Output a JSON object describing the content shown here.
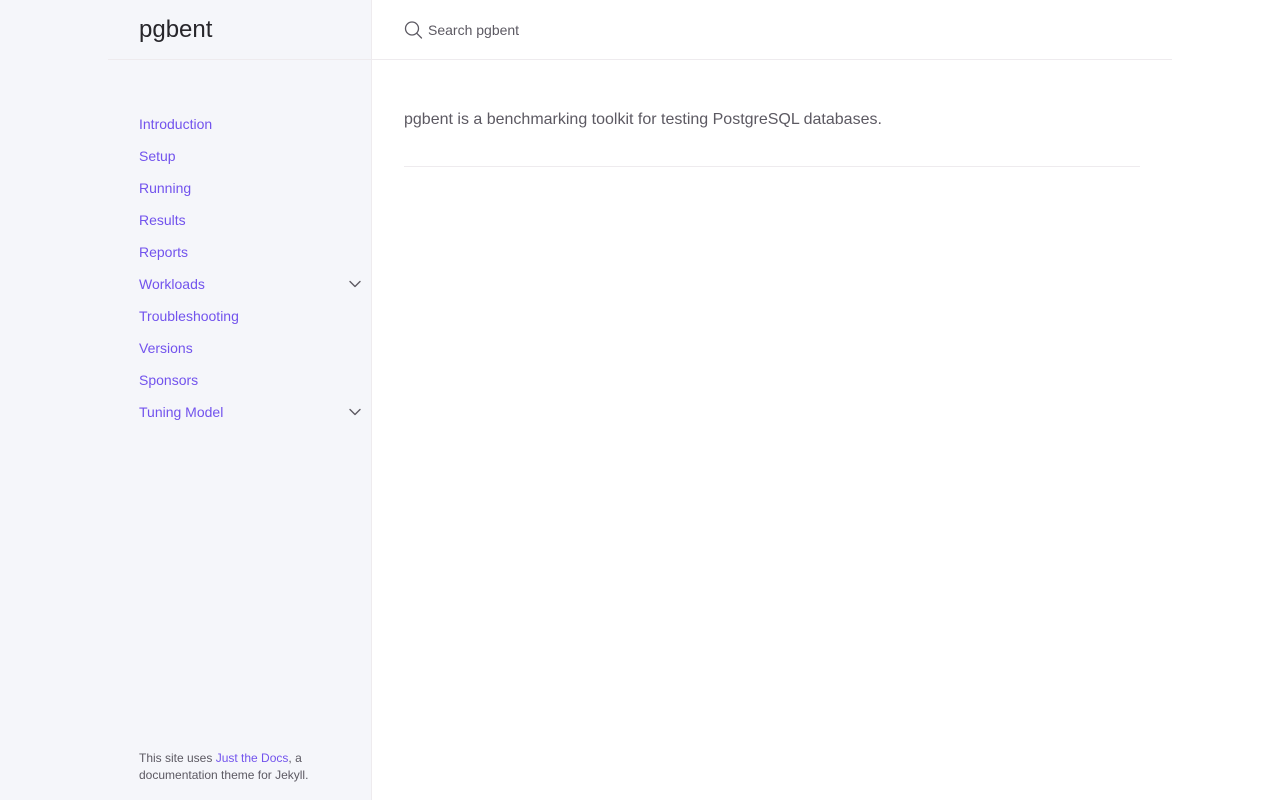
{
  "site": {
    "title": "pgbent"
  },
  "search": {
    "placeholder": "Search pgbent"
  },
  "nav": {
    "items": [
      {
        "label": "Introduction",
        "expandable": false
      },
      {
        "label": "Setup",
        "expandable": false
      },
      {
        "label": "Running",
        "expandable": false
      },
      {
        "label": "Results",
        "expandable": false
      },
      {
        "label": "Reports",
        "expandable": false
      },
      {
        "label": "Workloads",
        "expandable": true
      },
      {
        "label": "Troubleshooting",
        "expandable": false
      },
      {
        "label": "Versions",
        "expandable": false
      },
      {
        "label": "Sponsors",
        "expandable": false
      },
      {
        "label": "Tuning Model",
        "expandable": true
      }
    ]
  },
  "footer": {
    "prefix": "This site uses ",
    "link": "Just the Docs",
    "suffix": ", a documentation theme for Jekyll."
  },
  "main": {
    "intro": "pgbent is a benchmarking toolkit for testing PostgreSQL databases."
  },
  "colors": {
    "link": "#7253ed",
    "text": "#5c5962",
    "sidebar_bg": "#f5f6fa",
    "border": "#eeebee"
  }
}
